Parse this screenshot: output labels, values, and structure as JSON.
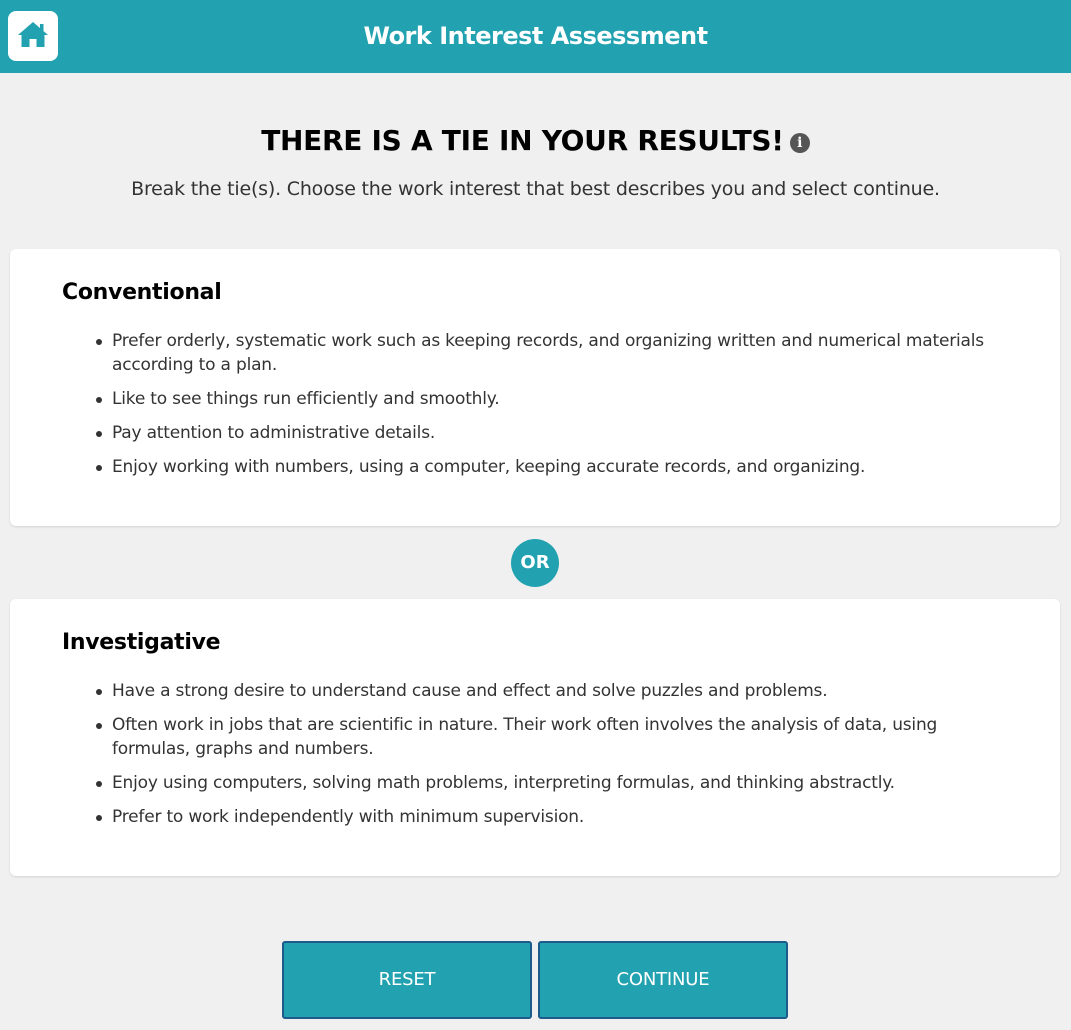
{
  "header": {
    "title": "Work Interest Assessment",
    "home_icon": "home-icon"
  },
  "colors": {
    "accent": "#22a2b0",
    "background": "#f0f0f0",
    "button_border": "#1e5a8a"
  },
  "main": {
    "heading": "THERE IS A TIE IN YOUR RESULTS!",
    "info_icon": "info-icon",
    "instructions": "Break the tie(s). Choose the work interest that best describes you and select continue.",
    "separator": "OR"
  },
  "options": [
    {
      "title": "Conventional",
      "bullets": [
        "Prefer orderly, systematic work such as keeping records, and organizing written and numerical materials according to a plan.",
        "Like to see things run efficiently and smoothly.",
        "Pay attention to administrative details.",
        "Enjoy working with numbers, using a computer, keeping accurate records, and organizing."
      ]
    },
    {
      "title": "Investigative",
      "bullets": [
        "Have a strong desire to understand cause and effect and solve puzzles and problems.",
        "Often work in jobs that are scientific in nature. Their work often involves the analysis of data, using formulas, graphs and numbers.",
        "Enjoy using computers, solving math problems, interpreting formulas, and thinking abstractly.",
        "Prefer to work independently with minimum supervision."
      ]
    }
  ],
  "buttons": {
    "reset": "RESET",
    "continue": "CONTINUE"
  }
}
